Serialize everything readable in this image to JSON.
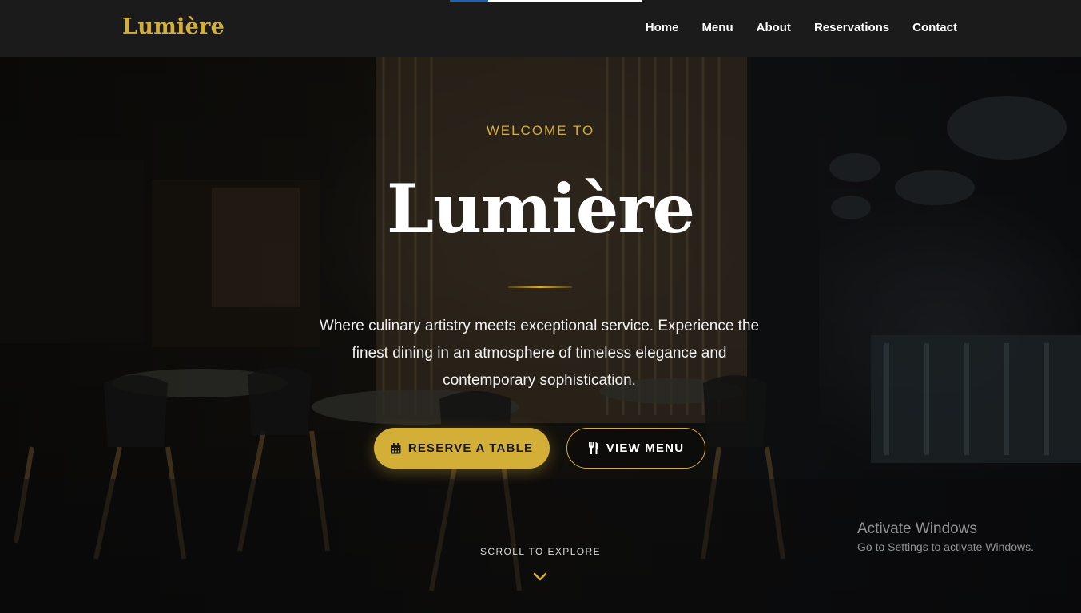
{
  "header": {
    "logo": "Lumière",
    "nav": [
      {
        "label": "Home"
      },
      {
        "label": "Menu"
      },
      {
        "label": "About"
      },
      {
        "label": "Reservations"
      },
      {
        "label": "Contact"
      }
    ],
    "page_load_progress": 0.2
  },
  "hero": {
    "eyebrow": "WELCOME TO",
    "title": "Lumière",
    "description": "Where culinary artistry meets exceptional service. Experience the finest dining in an atmosphere of timeless elegance and contemporary sophistication.",
    "primary_button": {
      "label": "RESERVE A TABLE",
      "icon": "calendar-icon"
    },
    "secondary_button": {
      "label": "VIEW MENU",
      "icon": "utensils-icon"
    },
    "scroll_hint": "SCROLL TO EXPLORE",
    "scroll_icon": "chevron-down-icon"
  },
  "os_watermark": {
    "title": "Activate Windows",
    "subtitle": "Go to Settings to activate Windows."
  },
  "colors": {
    "accent_gold": "#d4af37",
    "navbar_bg": "#1b1b1b",
    "text_white": "#ffffff"
  }
}
